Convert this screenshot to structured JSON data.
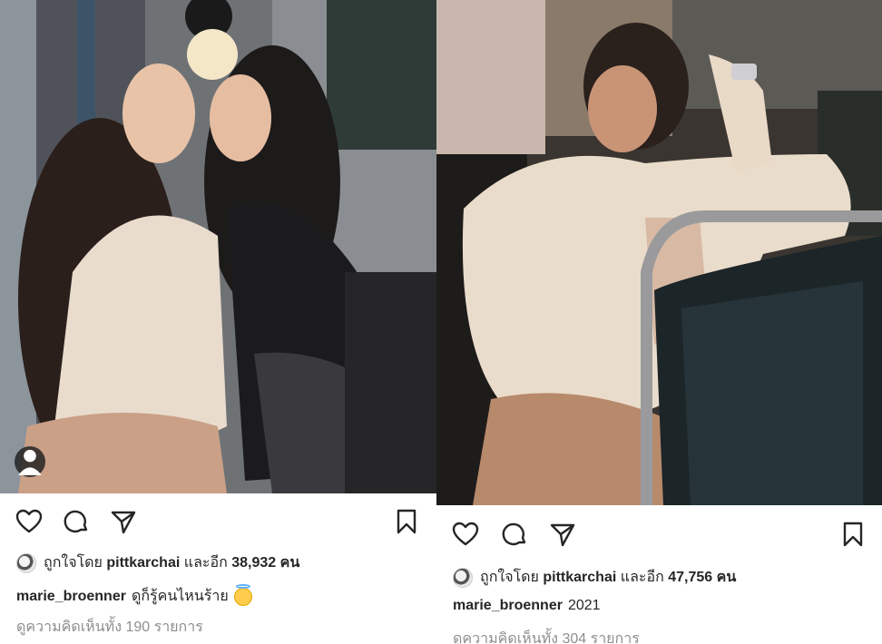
{
  "posts": [
    {
      "id": "left",
      "likes": {
        "prefix": "ถูกใจโดย",
        "user": "pittkarchai",
        "middle": "และอีก",
        "count": "38,932",
        "suffix": "คน"
      },
      "caption": {
        "username": "marie_broenner",
        "text": "ดูก็รู้คนไหนร้าย"
      },
      "comments_link": "ดูความคิดเห็นทั้ง 190 รายการ",
      "icons": [
        "heart-icon",
        "comment-icon",
        "share-icon",
        "bookmark-icon",
        "tagged-user-icon"
      ]
    },
    {
      "id": "right",
      "likes": {
        "prefix": "ถูกใจโดย",
        "user": "pittkarchai",
        "middle": "และอีก",
        "count": "47,756",
        "suffix": "คน"
      },
      "caption": {
        "username": "marie_broenner",
        "text": "2021"
      },
      "comments_link": "ดูความคิดเห็นทั้ง 304 รายการ",
      "icons": [
        "heart-icon",
        "comment-icon",
        "share-icon",
        "bookmark-icon"
      ]
    }
  ],
  "colors": {
    "text": "#262626",
    "muted": "#8e8e8e",
    "background": "#ffffff"
  }
}
